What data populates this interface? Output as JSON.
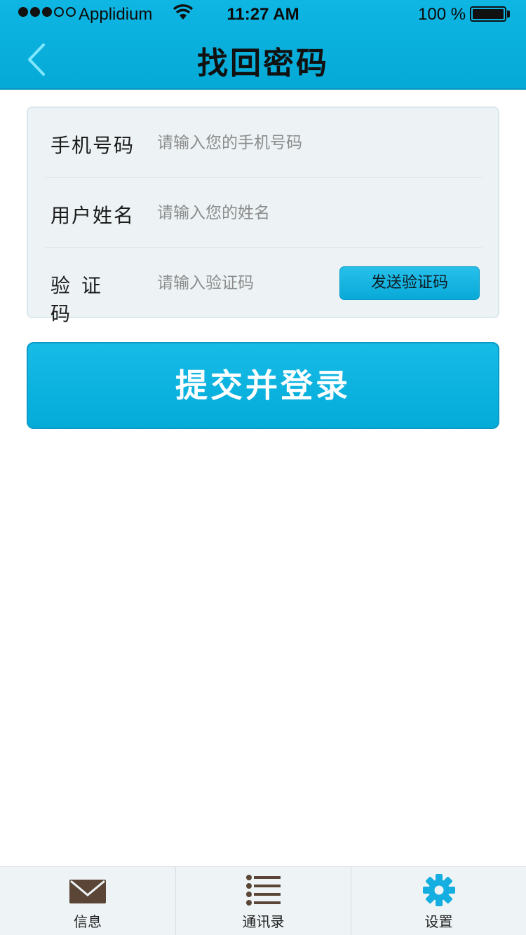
{
  "status_bar": {
    "carrier": "Applidium",
    "time": "11:27 AM",
    "battery": "100 %"
  },
  "nav": {
    "title": "找回密码",
    "back_icon": "chevron-left-icon"
  },
  "form": {
    "phone": {
      "label": "手机号码",
      "placeholder": "请输入您的手机号码",
      "value": ""
    },
    "name": {
      "label": "用户姓名",
      "placeholder": "请输入您的姓名",
      "value": ""
    },
    "code": {
      "label": "验证码",
      "placeholder": "请输入验证码",
      "value": "",
      "send_label": "发送验证码"
    }
  },
  "submit_label": "提交并登录",
  "tabs": [
    {
      "label": "信息",
      "icon": "envelope-icon"
    },
    {
      "label": "通讯录",
      "icon": "list-icon"
    },
    {
      "label": "设置",
      "icon": "gear-icon"
    }
  ],
  "colors": {
    "accent": "#08abd9",
    "accent_dark": "#0a9cc7",
    "card_bg": "#edf3f5",
    "icon_brown": "#5a4536",
    "icon_blue": "#14aee0"
  }
}
